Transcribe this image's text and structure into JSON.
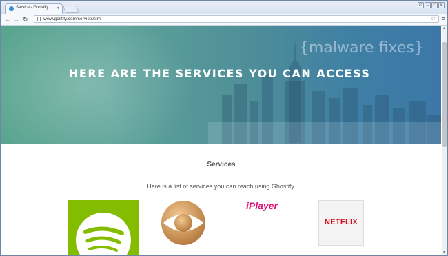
{
  "browser": {
    "tab_title": "Service - Ghostify",
    "tab_close": "×",
    "url": "www.gostify.com/service.html",
    "back": "←",
    "forward": "→",
    "reload": "↻",
    "star": "☆",
    "menu": "≡",
    "window_buttons": [
      "ʘ",
      "–",
      "□",
      "✕"
    ]
  },
  "hero": {
    "title": "HERE ARE THE SERVICES YOU CAN ACCESS",
    "watermark": "{malware fixes}"
  },
  "services": {
    "heading": "Services",
    "subtitle": "Here is a list of services you can reach using Ghostify.",
    "logos": [
      {
        "name": "spotify",
        "icon": "spotify-logo"
      },
      {
        "name": "cbs",
        "icon": "cbs-eye-logo"
      },
      {
        "name": "iplayer",
        "text": "iPlayer"
      },
      {
        "name": "netflix",
        "text": "NETFLIX"
      }
    ]
  },
  "colors": {
    "spotify_green": "#84bd00",
    "iplayer_pink": "#e01177",
    "netflix_red": "#d50f1b",
    "cbs_gold": "#c98a45"
  }
}
